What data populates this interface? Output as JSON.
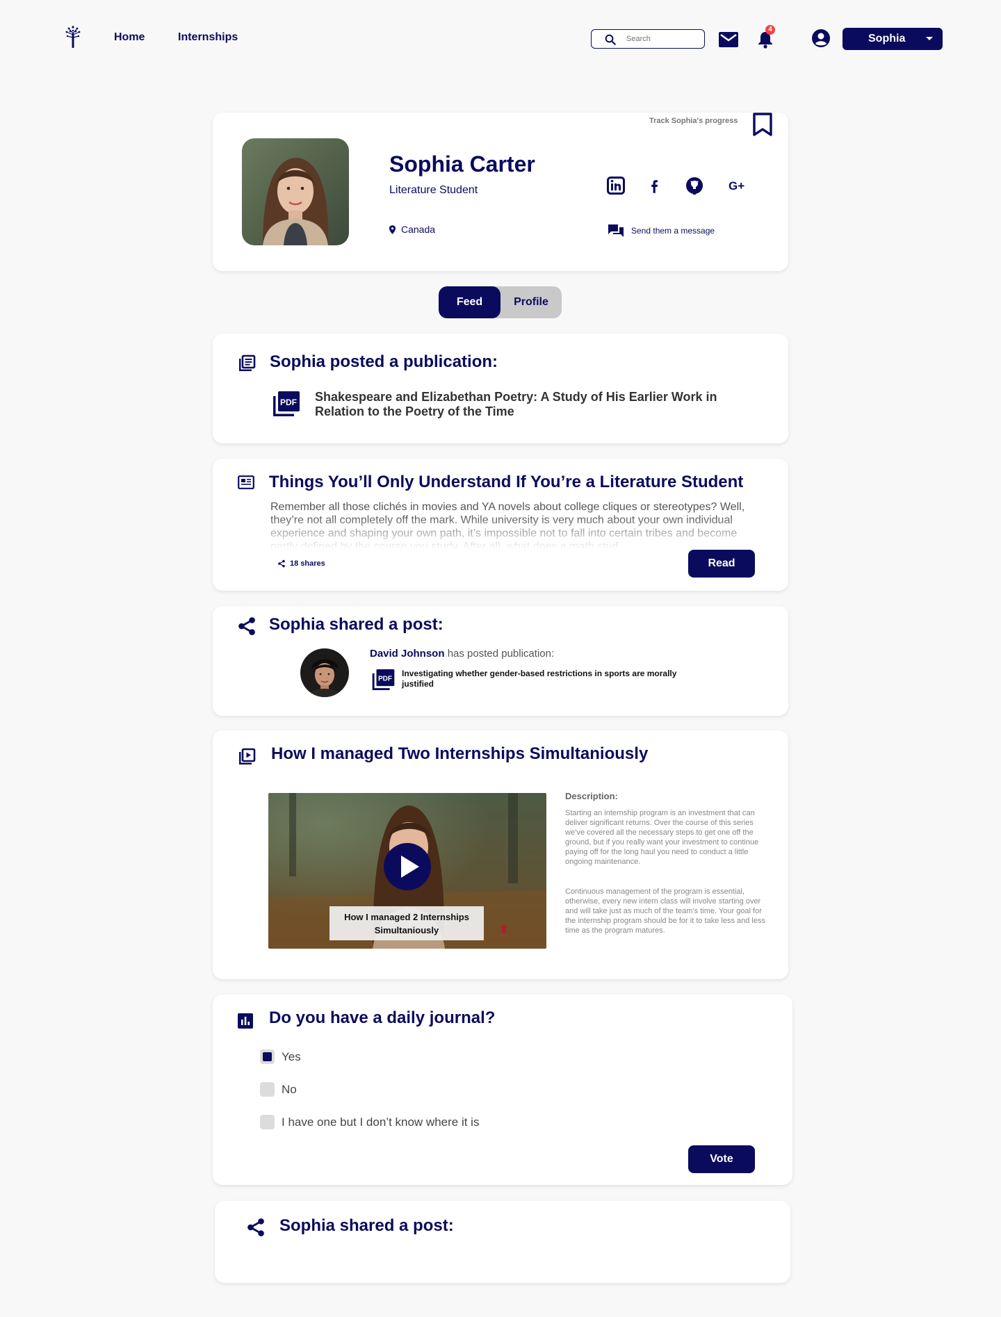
{
  "nav": {
    "home": "Home",
    "internships": "Internships",
    "search_placeholder": "Search",
    "notification_count": "4",
    "user_name": "Sophia"
  },
  "profile": {
    "name": "Sophia Carter",
    "major": "Literature Student",
    "location": "Canada",
    "track_label": "Track Sophia's progress",
    "message_label": "Send them a message",
    "socials": [
      "linkedin-icon",
      "facebook-icon",
      "github-icon",
      "google-plus-icon"
    ]
  },
  "tabs": {
    "feed": "Feed",
    "profile": "Profile",
    "active": "Feed"
  },
  "publication": {
    "title": "Sophia posted a publication:",
    "doc_title": "Shakespeare and Elizabethan Poetry: A Study of His Earlier Work in Relation to the Poetry of the Time"
  },
  "article": {
    "title": "Things You’ll Only Understand If You’re a Literature Student",
    "excerpt": "Remember all those clichés in movies and YA novels about college cliques or stereotypes? Well, they’re not all completely off the mark. While university is very much about your own individual experience and shaping your own path, it’s impossible not to fall into certain tribes and become partly defined by the course you study. After all, what does a math stud",
    "shares": "18 shares",
    "read_label": "Read"
  },
  "shared_post": {
    "title": "Sophia shared a post:",
    "author": "David Johnson",
    "action": "has posted publication:",
    "doc_title": "Investigating whether gender-based restrictions in sports are morally justified"
  },
  "video_post": {
    "title": "How I managed Two Internships Simultaniously",
    "video_caption": "How I managed 2 Internships Simultaniously",
    "description_heading": "Description:",
    "description_1": "Starting an internship program is an investment that can deliver significant returns. Over the course of this series we’ve covered all the necessary steps to get one off the ground, but if you really want your investment to continue paying off for the long haul you need to conduct a little ongoing maintenance.",
    "description_2": "Continuous management of the program is essential, otherwise, every new intern class will involve starting over and will take just as much of the team’s time. Your goal for the internship program should be for it to take less and less time as the program matures."
  },
  "poll": {
    "title": "Do you have a daily journal?",
    "options": [
      {
        "label": "Yes",
        "checked": true
      },
      {
        "label": "No",
        "checked": false
      },
      {
        "label": "I have one but I don’t know where it is",
        "checked": false
      }
    ],
    "vote_label": "Vote"
  },
  "shared_post_2": {
    "title": "Sophia shared a post:"
  },
  "colors": {
    "primary": "#0b0b5e",
    "badge": "#ef4444",
    "tab_inactive": "#c9c9c9",
    "background": "#f8f8f8"
  }
}
